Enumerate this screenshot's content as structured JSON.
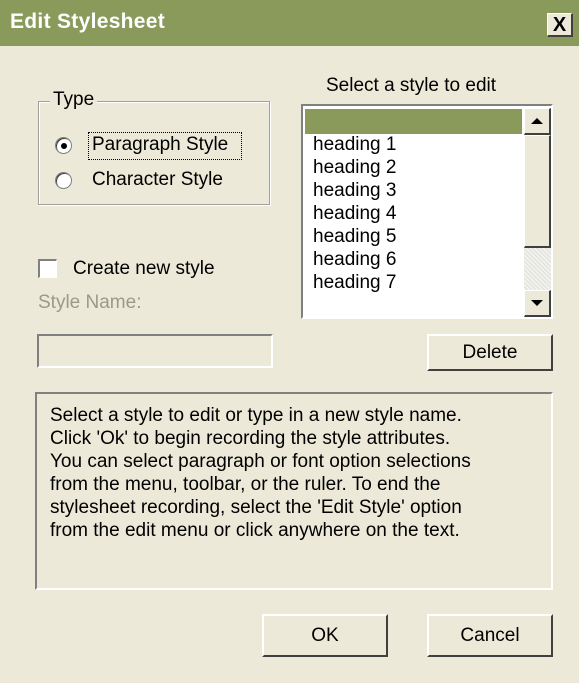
{
  "dialog": {
    "title": "Edit Stylesheet",
    "close_label": "X"
  },
  "type_group": {
    "legend": "Type",
    "options": [
      {
        "label": "Paragraph Style",
        "selected": true
      },
      {
        "label": "Character Style",
        "selected": false
      }
    ]
  },
  "create_new": {
    "label": "Create new style",
    "checked": false
  },
  "style_name": {
    "label": "Style Name:",
    "value": ""
  },
  "style_list": {
    "label": "Select a style to edit",
    "selected_index": 0,
    "items": [
      "",
      "heading 1",
      "heading 2",
      "heading 3",
      "heading 4",
      "heading 5",
      "heading 6",
      "heading 7"
    ]
  },
  "buttons": {
    "delete": "Delete",
    "ok": "OK",
    "cancel": "Cancel"
  },
  "info": {
    "lines": [
      "Select a style to edit or type in a new style name.",
      "Click 'Ok' to begin recording the style attributes.",
      "You can select paragraph or font option selections",
      "from the menu, toolbar, or the ruler.  To end the",
      "stylesheet recording, select the 'Edit Style' option",
      "from the edit menu or click anywhere on the text."
    ]
  },
  "colors": {
    "titlebar": "#8a9a5b",
    "dialog_bg": "#ece9d8",
    "selection": "#8a9a5b",
    "disabled_text": "#9a9a8a"
  }
}
